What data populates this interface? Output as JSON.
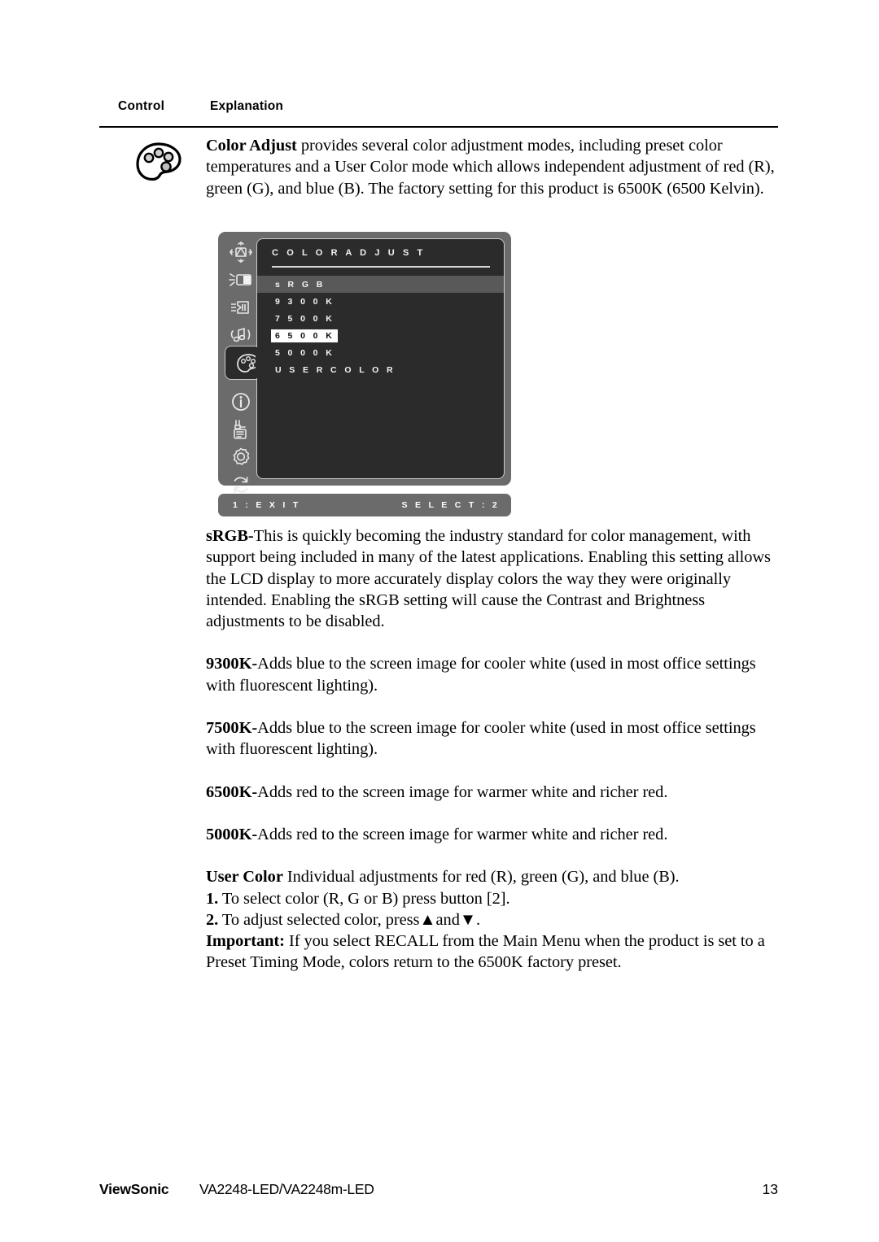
{
  "table_header": {
    "control": "Control",
    "explanation": "Explanation"
  },
  "control_icon": "color-palette-icon",
  "intro": {
    "term": "Color Adjust",
    "text": " provides several color adjustment modes, including preset color temperatures and a User Color mode which allows independent adjustment of red (R), green (G), and blue (B). The factory setting for this product is 6500K (6500 Kelvin)."
  },
  "osd": {
    "title": "C O L O R    A D J U S T",
    "sidebar_icons": [
      "auto-image-adjust-icon",
      "brightness-contrast-icon",
      "input-select-icon",
      "audio-adjust-icon",
      "color-adjust-palette-icon",
      "information-icon",
      "manual-image-adjust-icon",
      "setup-menu-icon",
      "memory-recall-icon"
    ],
    "items": [
      {
        "label": "s R G B",
        "highlighted": true,
        "boxed": false
      },
      {
        "label": "9 3 0 0 K",
        "highlighted": false,
        "boxed": false
      },
      {
        "label": "7 5 0 0 K",
        "highlighted": false,
        "boxed": false
      },
      {
        "label": "6 5 0 0 K",
        "highlighted": false,
        "boxed": true
      },
      {
        "label": "5 0 0 0 K",
        "highlighted": false,
        "boxed": false
      },
      {
        "label": "U S E R    C O L O R",
        "highlighted": false,
        "boxed": false
      }
    ],
    "footer_left": "1 : E X I T",
    "footer_right": "S E L E C T : 2",
    "colors": {
      "bezel": "#6b6b6b",
      "panel": "#2b2b2b",
      "highlight": "#595959",
      "text": "#f4f4f4",
      "boxed_bg": "#ffffff",
      "boxed_text": "#111111"
    }
  },
  "paragraphs": [
    {
      "term": "sRGB-",
      "text": "This is quickly becoming the industry standard for color management, with support being included in many of the latest applications. Enabling this setting allows the LCD display to more accurately display colors the way they were originally intended. Enabling the sRGB setting will cause the Contrast and Brightness adjustments to be disabled."
    },
    {
      "term": "9300K-",
      "text": "Adds blue to the screen image for cooler white (used in most office settings with fluorescent lighting)."
    },
    {
      "term": "7500K-",
      "text": "Adds blue to the screen image for cooler white (used in most office settings with fluorescent lighting)."
    },
    {
      "term": "6500K-",
      "text": "Adds red to the screen image for warmer white and richer red."
    },
    {
      "term": "5000K-",
      "text": "Adds red to the screen image for warmer white and richer red."
    }
  ],
  "user_color": {
    "term": "User Color",
    "lead": " Individual adjustments for red (R), green (G),  and blue (B).",
    "step1_num": "1.",
    "step1_text": " To select color (R, G or B) press button [2].",
    "step2_num": "2.",
    "step2_text_a": " To adjust selected color, press",
    "step2_up": "▲",
    "step2_and": "and",
    "step2_down": "▼",
    "step2_text_b": ".",
    "important_term": "Important:",
    "important_text": " If you select RECALL from the Main Menu when the product is set to a Preset Timing Mode, colors return to the 6500K factory preset."
  },
  "footer": {
    "brand": "ViewSonic",
    "model": "VA2248-LED/VA2248m-LED",
    "page": "13"
  }
}
